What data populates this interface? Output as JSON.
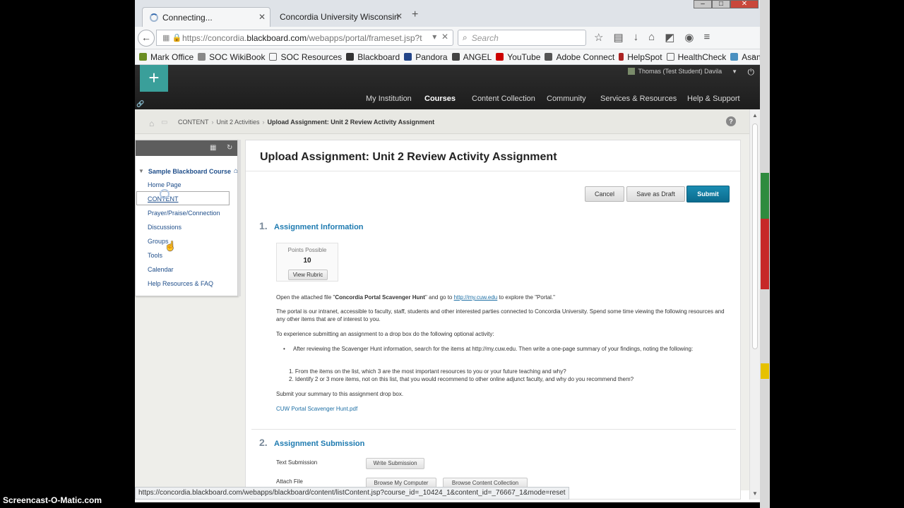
{
  "browser": {
    "tabs": [
      {
        "label": "Connecting...",
        "loading": true
      },
      {
        "label": "Concordia University Wisconsin"
      }
    ],
    "url": {
      "prefix": "https://concordia.",
      "domain": "blackboard.com",
      "rest": "/webapps/portal/frameset.jsp?tab_tab"
    },
    "search_placeholder": "Search",
    "status_url": "https://concordia.blackboard.com/webapps/blackboard/content/listContent.jsp?course_id=_10424_1&content_id=_76667_1&mode=reset"
  },
  "bookmarks": [
    {
      "label": "Mark Office",
      "color": "#6b8e23"
    },
    {
      "label": "SOC WikiBook",
      "color": "#888888"
    },
    {
      "label": "SOC Resources",
      "color": "#ffffff"
    },
    {
      "label": "Blackboard",
      "color": "#333333"
    },
    {
      "label": "Pandora",
      "color": "#224488"
    },
    {
      "label": "ANGEL",
      "color": "#444444"
    },
    {
      "label": "YouTube",
      "color": "#cc0000"
    },
    {
      "label": "Adobe Connect",
      "color": "#555555"
    },
    {
      "label": "HelpSpot",
      "color": "#aa2222"
    },
    {
      "label": "HealthCheck",
      "color": "#ffffff"
    },
    {
      "label": "Asana",
      "color": "#4a90c0"
    }
  ],
  "blackboard": {
    "user_name": "Thomas (Test Student) Davila",
    "nav_tabs": [
      "My Institution",
      "Courses",
      "Content Collection",
      "Community",
      "Services & Resources",
      "Help & Support"
    ],
    "active_tab": "Courses",
    "accent": "#8bc34a"
  },
  "breadcrumb": {
    "items": [
      "CONTENT",
      "Unit 2 Activities"
    ],
    "current": "Upload Assignment: Unit 2 Review Activity Assignment",
    "help": "?"
  },
  "course_menu": {
    "title": "Sample Blackboard Course",
    "items": [
      "Home Page",
      "CONTENT",
      "Prayer/Praise/Connection",
      "Discussions",
      "Groups",
      "Tools",
      "Calendar",
      "Help Resources & FAQ"
    ]
  },
  "page": {
    "title": "Upload Assignment: Unit 2 Review Activity Assignment",
    "buttons": {
      "cancel": "Cancel",
      "save_draft": "Save as Draft",
      "submit": "Submit"
    },
    "section1": {
      "number": "1.",
      "title": "Assignment Information",
      "points_label": "Points Possible",
      "points_value": "10",
      "rubric_label": "View Rubric",
      "intro_before": "Open the attached file \"",
      "intro_file": "Concordia Portal Scavenger Hunt",
      "intro_mid": "\" and go to ",
      "intro_link": "http://my.cuw.edu",
      "intro_after": " to explore the \"Portal.\"",
      "para2": "The portal is our intranet, accessible to faculty, staff, students and other interested parties connected to Concordia University. Spend some time viewing the following resources and any other items that are of interest to you.",
      "para3": "To experience submitting an assignment to a drop box do the following optional activity:",
      "bullet": "After reviewing the Scavenger Hunt information, search for the items at http://my.cuw.edu. Then write a one-page summary of your findings, noting the following:",
      "numbered": [
        "From the items on the list, which 3 are the most important resources to you or your future teaching and why?",
        "Identify 2 or 3 more items, not on this list, that you would recommend to other online adjunct faculty, and why do you recommend them?"
      ],
      "para4": "Submit your summary to this assignment drop box.",
      "attachment": "CUW Portal Scavenger Hunt.pdf"
    },
    "section2": {
      "number": "2.",
      "title": "Assignment Submission",
      "text_submission_label": "Text Submission",
      "write_submission": "Write Submission",
      "attach_file_label": "Attach File",
      "browse_computer": "Browse My Computer",
      "browse_collection": "Browse Content Collection"
    }
  },
  "watermark": "Screencast-O-Matic.com"
}
